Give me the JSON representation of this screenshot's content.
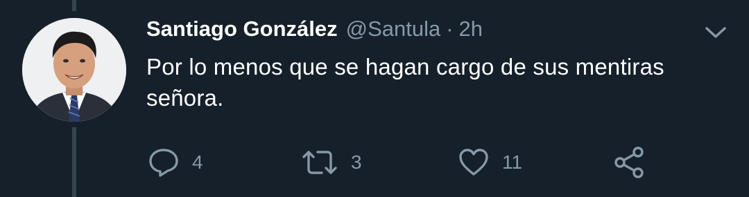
{
  "tweet": {
    "author_name": "Santiago González",
    "handle": "@Santula",
    "separator": "·",
    "time": "2h",
    "text": "Por lo menos que se hagan cargo de sus mentiras señora.",
    "avatar_icon": "profile-photo",
    "menu_icon": "chevron-down-icon"
  },
  "actions": {
    "reply": {
      "icon": "reply-icon",
      "count": "4"
    },
    "retweet": {
      "icon": "retweet-icon",
      "count": "3"
    },
    "like": {
      "icon": "heart-icon",
      "count": "11"
    },
    "share": {
      "icon": "share-icon",
      "count": ""
    }
  },
  "colors": {
    "background": "#15202b",
    "primary_text": "#ffffff",
    "secondary_text": "#8899a6",
    "thread_line": "#38444d"
  }
}
